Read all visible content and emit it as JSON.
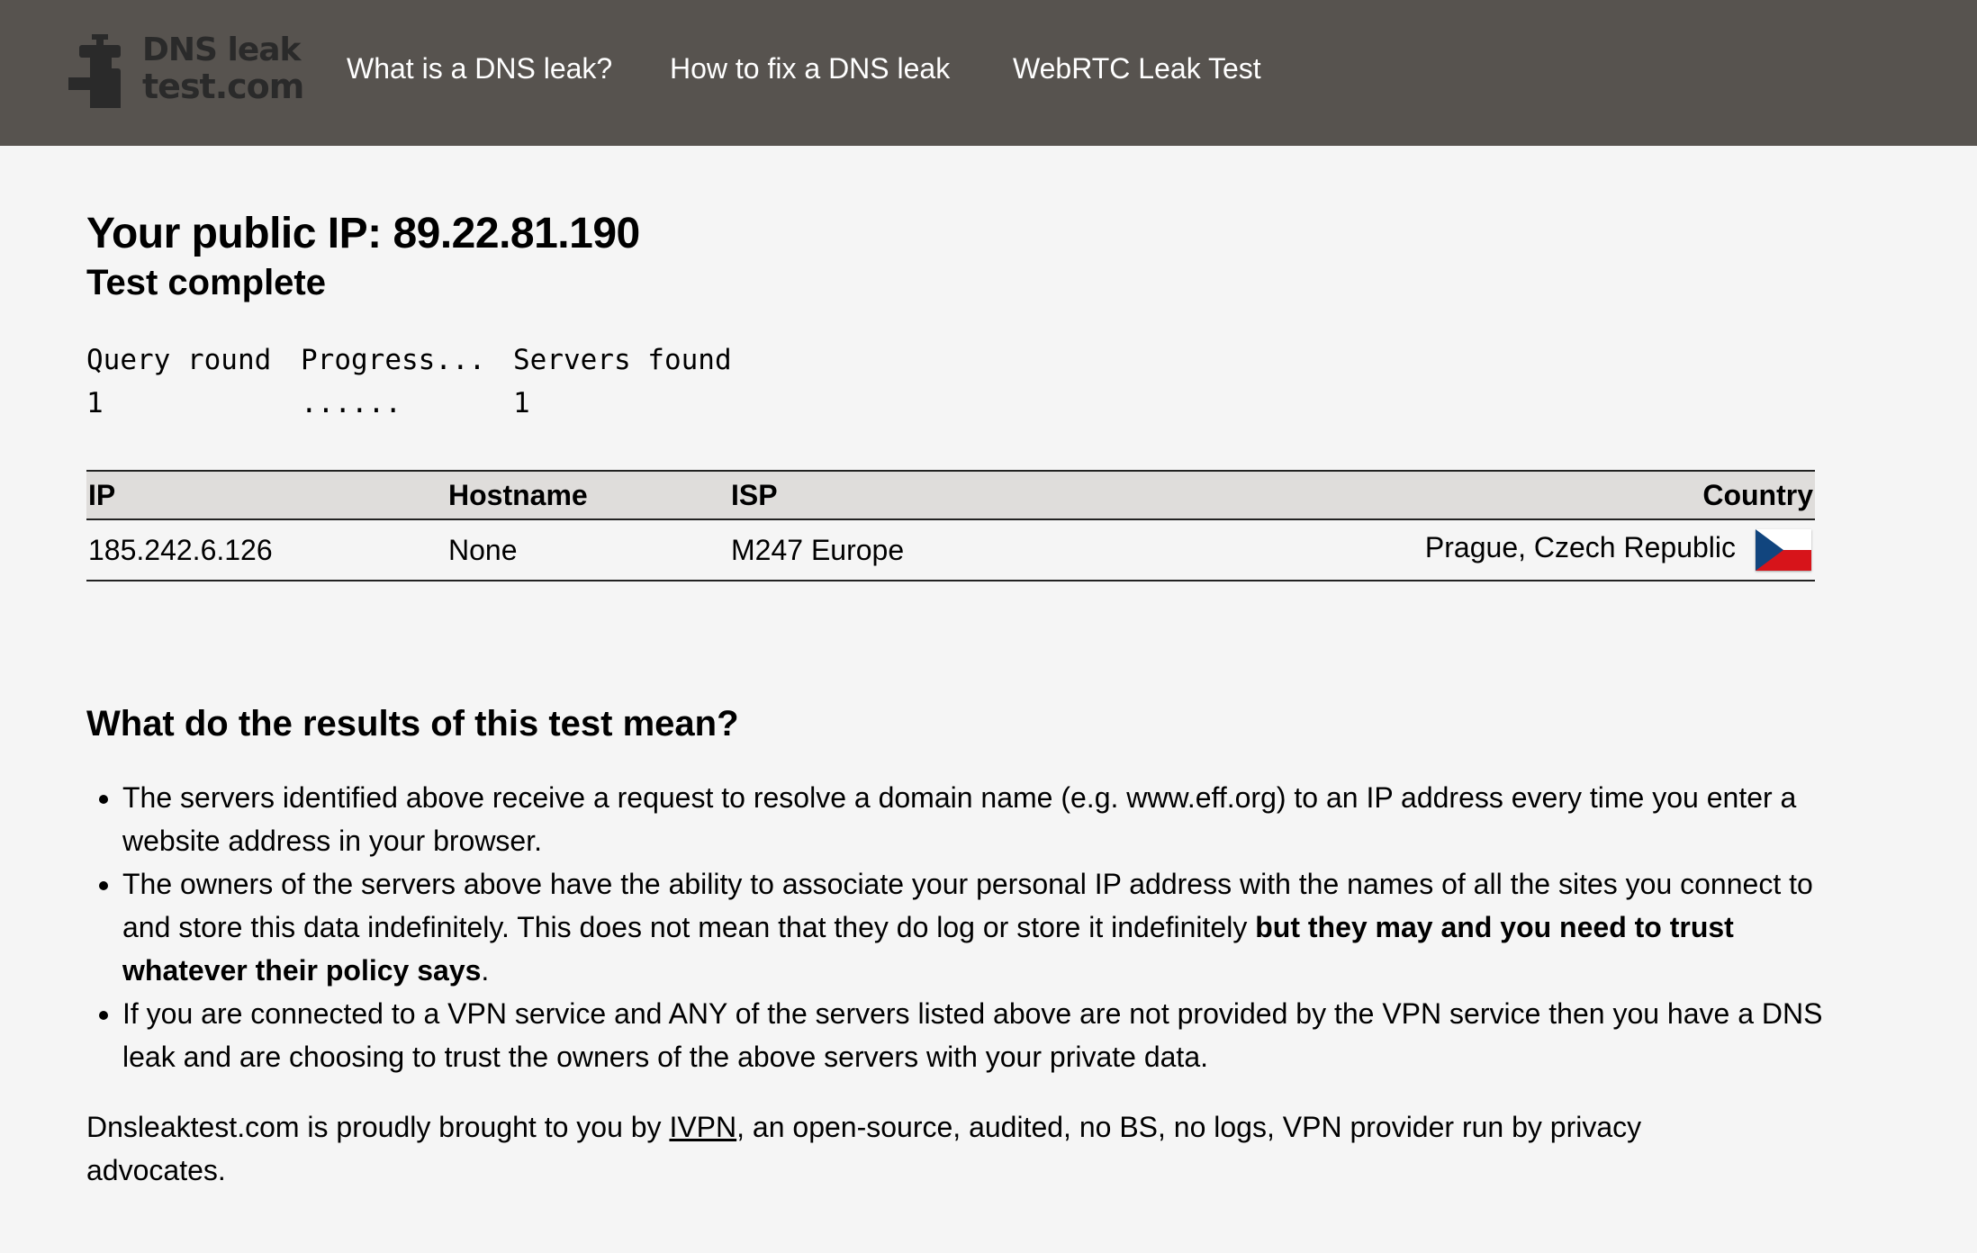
{
  "header": {
    "logo_line1": "DNS leak",
    "logo_line2": "test.com",
    "nav": [
      {
        "label": "What is a DNS leak?"
      },
      {
        "label": "How to fix a DNS leak"
      },
      {
        "label": "WebRTC Leak Test"
      }
    ],
    "bg_color": "#57534f"
  },
  "main": {
    "ip_heading": "Your public IP: 89.22.81.190",
    "status": "Test complete",
    "progress": {
      "headers": [
        "Query round",
        "Progress...",
        "Servers found"
      ],
      "values": [
        "1",
        "......",
        "1"
      ]
    },
    "table": {
      "headers": [
        "IP",
        "Hostname",
        "ISP",
        "Country"
      ],
      "rows": [
        {
          "ip": "185.242.6.126",
          "hostname": "None",
          "isp": "M247 Europe",
          "country": "Prague, Czech Republic",
          "flag_icon": "czech-flag-icon"
        }
      ]
    },
    "explanation": {
      "heading": "What do the results of this test mean?",
      "points": [
        {
          "text": "The servers identified above receive a request to resolve a domain name (e.g. www.eff.org) to an IP address every time you enter a website address in your browser."
        },
        {
          "text": "The owners of the servers above have the ability to associate your personal IP address with the names of all the sites you connect to and store this data indefinitely. This does not mean that they do log or store it indefinitely ",
          "bold": "but they may and you need to trust whatever their policy says",
          "tail": "."
        },
        {
          "text": "If you are connected to a VPN service and ANY of the servers listed above are not provided by the VPN service then you have a DNS leak and are choosing to trust the owners of the above servers with your private data."
        }
      ]
    },
    "footer": {
      "prefix": "Dnsleaktest.com is proudly brought to you by ",
      "link": "IVPN",
      "suffix": ", an open-source, audited, no BS, no logs, VPN provider run by privacy advocates."
    }
  }
}
